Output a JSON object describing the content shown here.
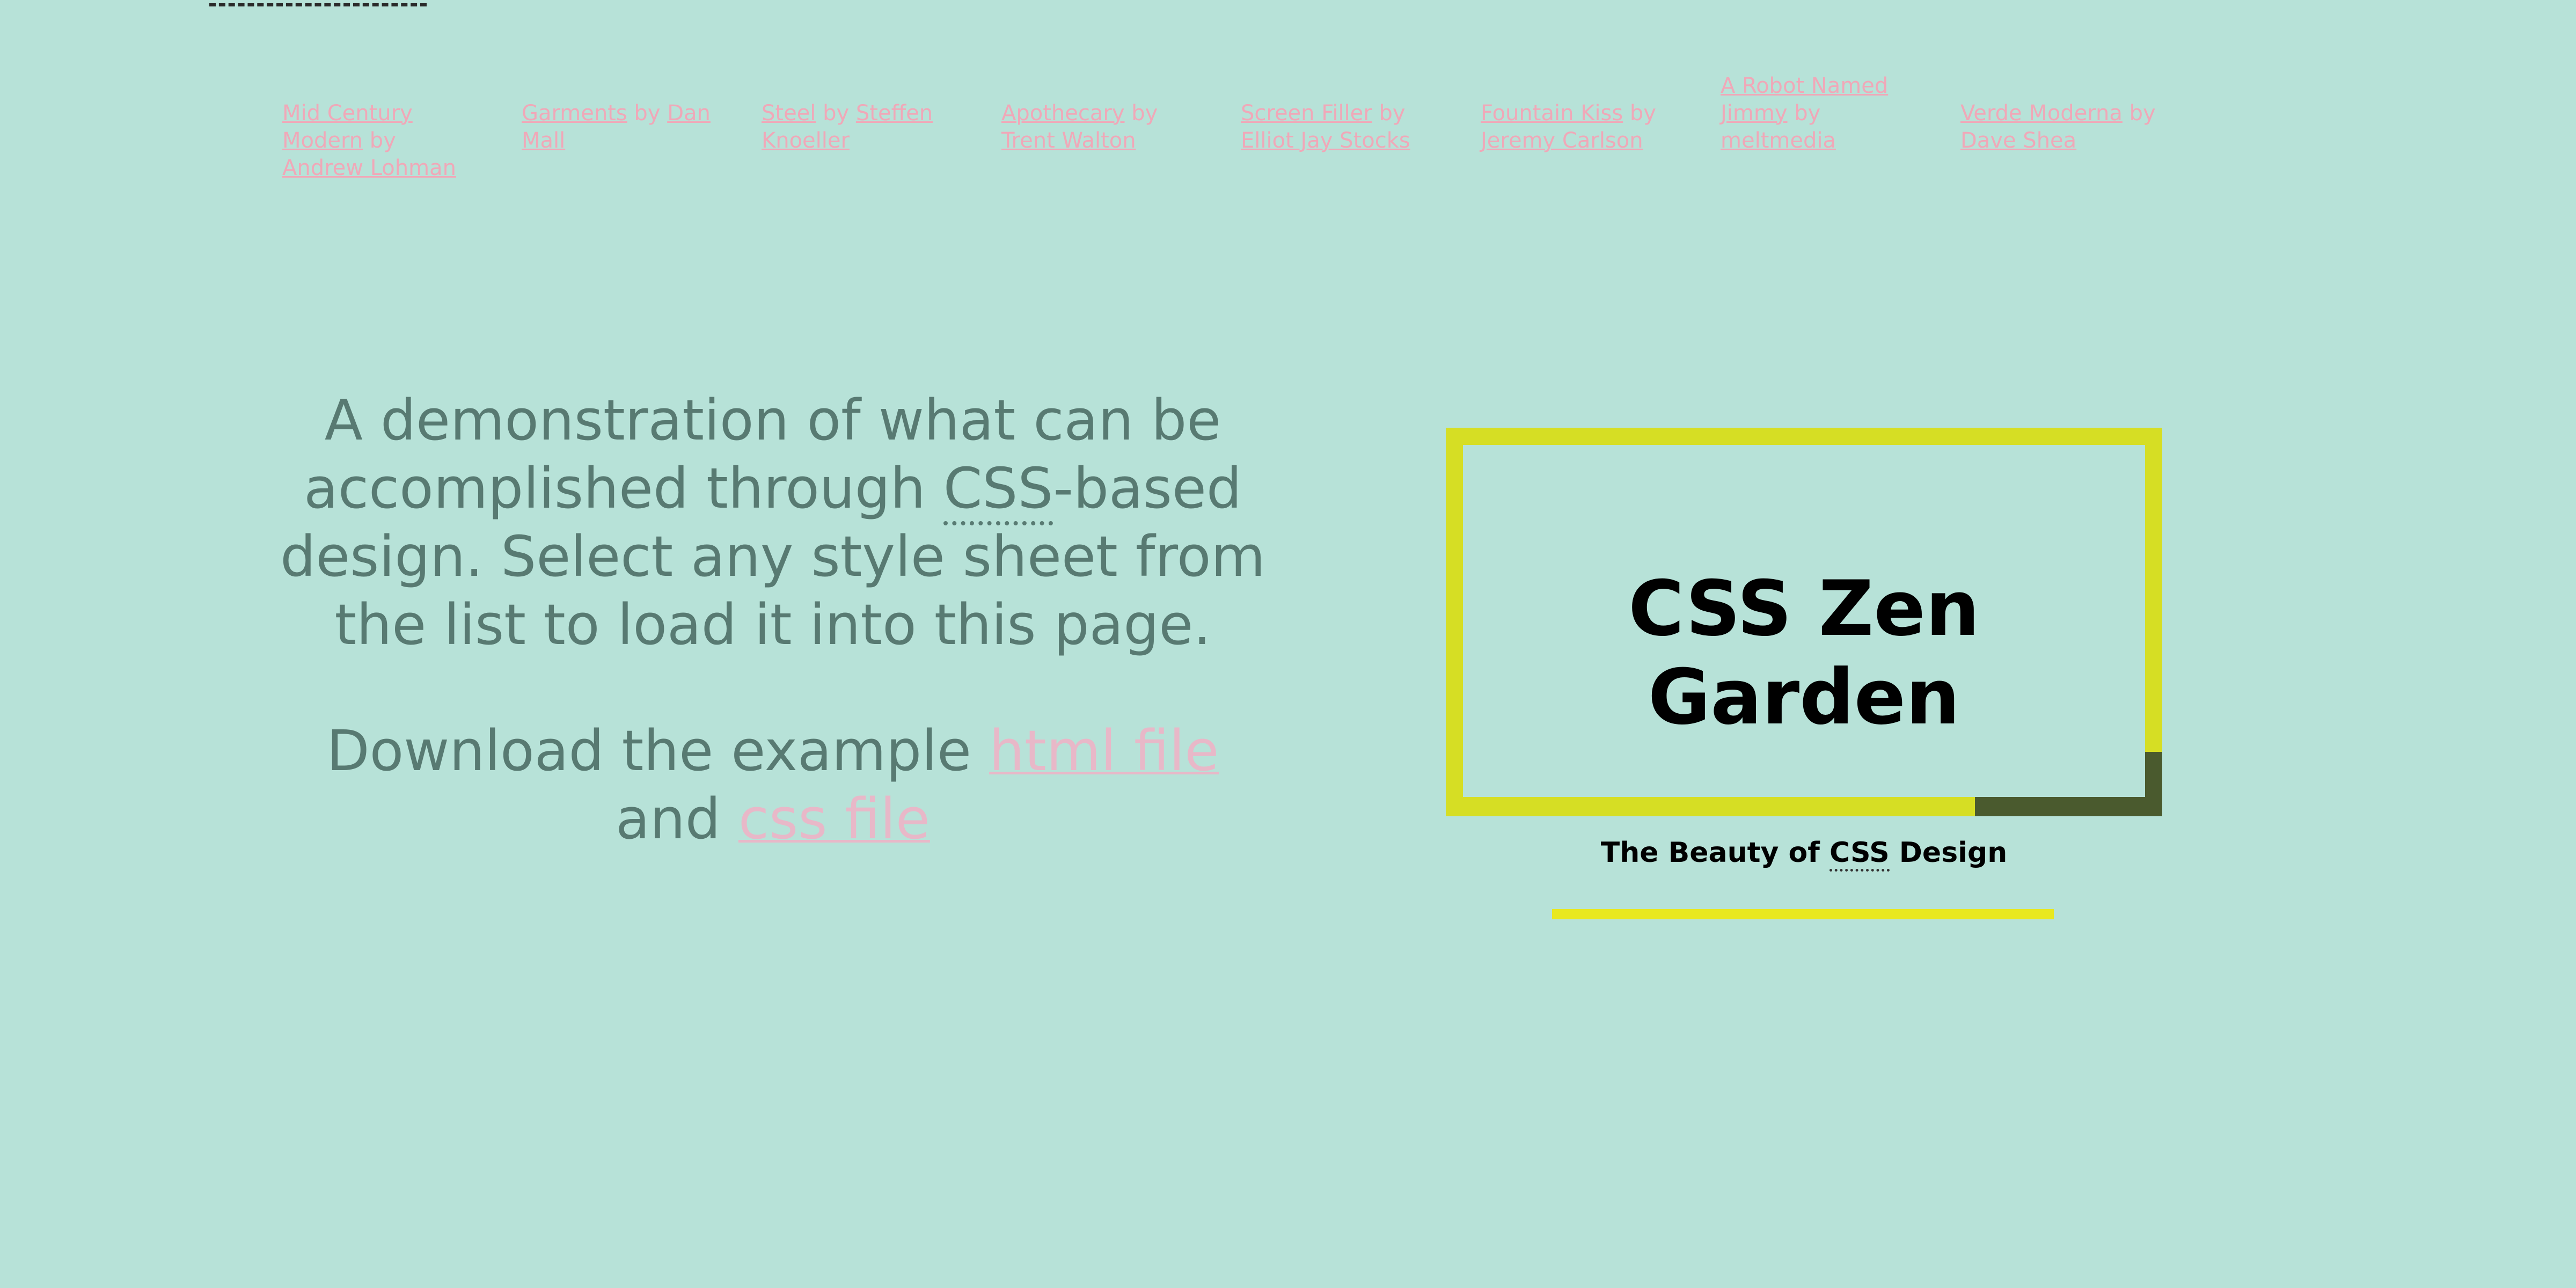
{
  "designs": [
    {
      "title": "Mid Century Modern",
      "by": "by",
      "author": "Andrew Lohman"
    },
    {
      "title": "Garments",
      "by": "by",
      "author": "Dan Mall"
    },
    {
      "title": "Steel",
      "by": "by",
      "author": "Steffen Knoeller"
    },
    {
      "title": "Apothecary",
      "by": "by",
      "author": "Trent Walton"
    },
    {
      "title": "Screen Filler",
      "by": "by",
      "author": "Elliot Jay Stocks"
    },
    {
      "title": "Fountain Kiss",
      "by": "by",
      "author": "Jeremy Carlson"
    },
    {
      "title": "A Robot Named Jimmy",
      "by": "by",
      "author": "meltmedia"
    },
    {
      "title": "Verde Moderna",
      "by": "by",
      "author": "Dave Shea"
    }
  ],
  "intro": {
    "p1_part1": "A demonstration of what can be accomplished through ",
    "p1_abbr": "CSS",
    "p1_part2": "-based design. Select any style sheet from the list to load it into this page.",
    "p2_part1": "Download the example ",
    "html_link": "html file",
    "p2_and": " and ",
    "css_link": "css file"
  },
  "header": {
    "title": "CSS Zen Garden",
    "tagline_part1": "The Beauty of ",
    "tagline_abbr": "CSS",
    "tagline_part2": " Design"
  },
  "colors": {
    "background": "#b7e2d8",
    "link": "#f0a8b8",
    "intro_text": "#587a72",
    "frame": "#d6de24",
    "frame_corner": "#4a5a2e",
    "underline_bar": "#e8e820"
  }
}
